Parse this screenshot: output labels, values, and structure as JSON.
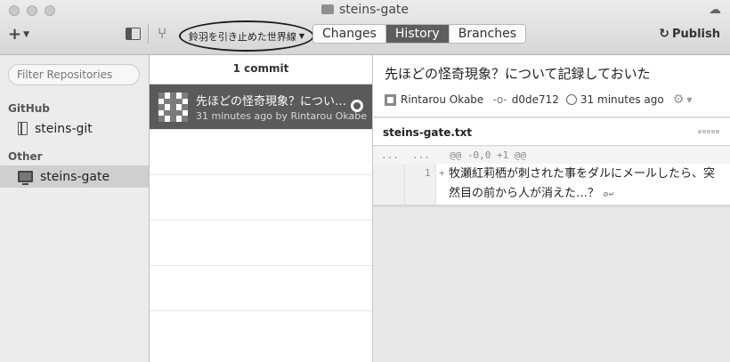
{
  "window": {
    "title": "steins-gate"
  },
  "toolbar": {
    "add_label": "+",
    "branch": "鈴羽を引き止めた世界線",
    "tabs": [
      {
        "label": "Changes",
        "active": false
      },
      {
        "label": "History",
        "active": true
      },
      {
        "label": "Branches",
        "active": false
      }
    ],
    "publish_label": "Publish"
  },
  "sidebar": {
    "filter_placeholder": "Filter Repositories",
    "sections": [
      {
        "label": "GitHub",
        "repos": [
          {
            "name": "steins-git",
            "icon": "book-icon"
          }
        ]
      },
      {
        "label": "Other",
        "repos": [
          {
            "name": "steins-gate",
            "icon": "monitor-icon",
            "selected": true
          }
        ]
      }
    ]
  },
  "history": {
    "commit_count": "1 commit",
    "commits": [
      {
        "title": "先ほどの怪奇現象？につい…",
        "meta": "31 minutes ago by Rintarou Okabe"
      }
    ]
  },
  "detail": {
    "title": "先ほどの怪奇現象？について記録しておいた",
    "author": "Rintarou Okabe",
    "sha": "d0de712",
    "time": "31 minutes ago",
    "file": {
      "name": "steins-gate.txt",
      "hunk_old": "...",
      "hunk_new": "...",
      "hunk_header": "@@ -0,0 +1 @@",
      "line_number": "1",
      "added_line": "牧瀬紅莉栖が刺された事をダルにメールしたら、突然目の前から人が消えた…？"
    }
  },
  "colors": {
    "selected_row": "#5a5a5a",
    "active_tab": "#5e5e5e"
  }
}
